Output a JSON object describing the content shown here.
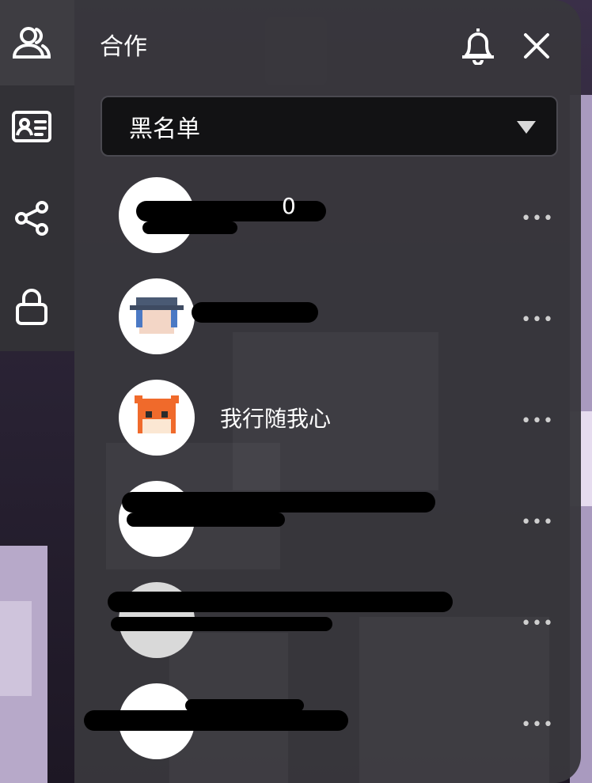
{
  "header": {
    "title": "合作",
    "bell_icon": "bell-icon",
    "close_icon": "close-icon"
  },
  "sidebar": {
    "items": [
      {
        "icon": "friends-icon"
      },
      {
        "icon": "id-card-icon"
      },
      {
        "icon": "share-icon"
      },
      {
        "icon": "lock-icon"
      }
    ]
  },
  "filter": {
    "selected": "黑名单",
    "icon": "dropdown-caret-icon"
  },
  "list": [
    {
      "name": "0",
      "more": "•••"
    },
    {
      "name": "",
      "more": "•••"
    },
    {
      "name": "我行随我心",
      "more": "•••"
    },
    {
      "name": "",
      "more": "•••"
    },
    {
      "name": "",
      "more": "•••"
    },
    {
      "name": "",
      "more": "•••"
    }
  ]
}
